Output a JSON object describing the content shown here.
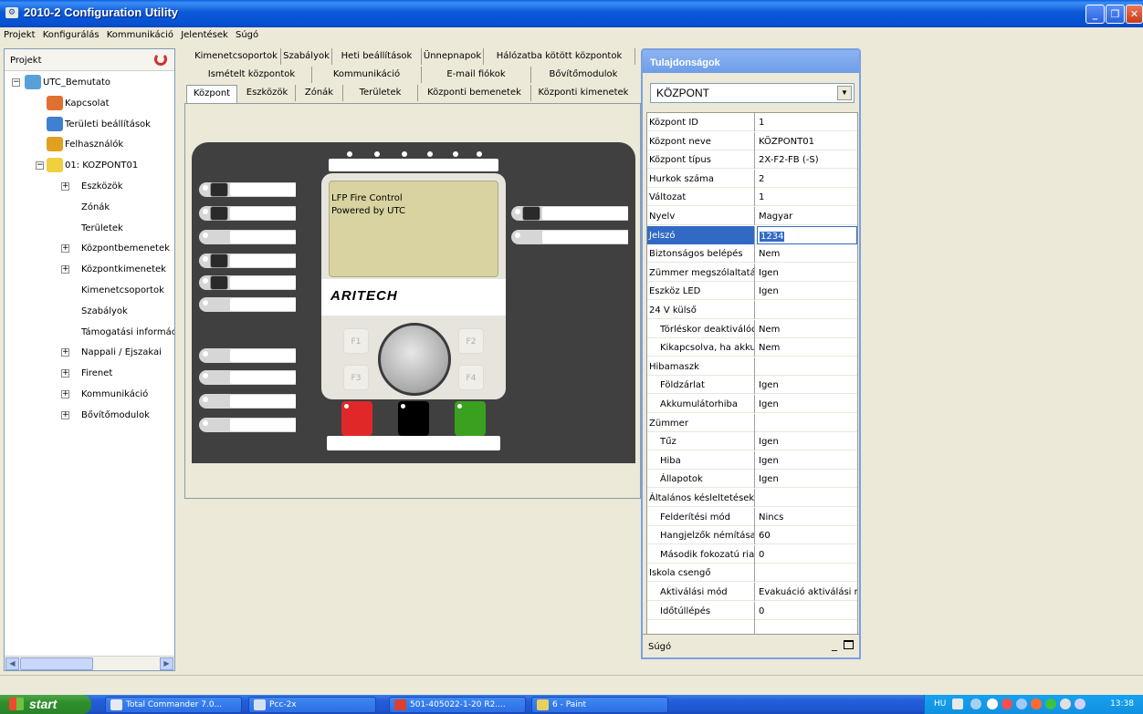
{
  "window": {
    "title": "2010-2 Configuration Utility"
  },
  "menu": [
    "Projekt",
    "Konfigurálás",
    "Kommunikáció",
    "Jelentések",
    "Súgó"
  ],
  "left_panel": {
    "header": "Projekt",
    "tree": [
      {
        "label": "UTC_Bemutato",
        "level": 0,
        "expander": "−"
      },
      {
        "label": "Kapcsolat",
        "level": 1
      },
      {
        "label": "Területi beállítások",
        "level": 1
      },
      {
        "label": "Felhasználók",
        "level": 1
      },
      {
        "label": "01: KÖZPONT01",
        "level": 1,
        "expander": "−"
      },
      {
        "label": "Eszközök",
        "level": 2,
        "expander": "+"
      },
      {
        "label": "Zónák",
        "level": 2
      },
      {
        "label": "Területek",
        "level": 2
      },
      {
        "label": "Központbemenetek",
        "level": 2,
        "expander": "+"
      },
      {
        "label": "Központkimenetek",
        "level": 2,
        "expander": "+"
      },
      {
        "label": "Kimenetcsoportok",
        "level": 2
      },
      {
        "label": "Szabályok",
        "level": 2
      },
      {
        "label": "Támogatási információ",
        "level": 2
      },
      {
        "label": "Nappali / Éjszakai",
        "level": 2,
        "expander": "+"
      },
      {
        "label": "Firenet",
        "level": 2,
        "expander": "+"
      },
      {
        "label": "Kommunikáció",
        "level": 2,
        "expander": "+"
      },
      {
        "label": "Bővítőmodulok",
        "level": 2,
        "expander": "+"
      }
    ]
  },
  "tabs": {
    "row1": [
      "Kimenetcsoportok",
      "Szabályok",
      "Heti beállítások",
      "Ünnepnapok",
      "Hálózatba kötött központok"
    ],
    "row2": [
      "Ismételt központok",
      "Kommunikáció",
      "E-mail fiókok",
      "Bővítőmodulok"
    ],
    "row3": [
      "Központ",
      "Eszközök",
      "Zónák",
      "Területek",
      "Központi bemenetek",
      "Központi kimenetek"
    ],
    "active": "Központ"
  },
  "panel": {
    "lcd_line1": "LFP Fire Control",
    "lcd_line2": "Powered by UTC",
    "brand": "ARITECH",
    "fkeys": [
      "F1",
      "F2",
      "F3",
      "F4"
    ]
  },
  "properties": {
    "title": "Tulajdonságok",
    "selected_object": "KÖZPONT",
    "rows": [
      {
        "key": "Központ ID",
        "value": "1"
      },
      {
        "key": "Központ neve",
        "value": "KÖZPONT01"
      },
      {
        "key": "Központ típus",
        "value": "2X-F2-FB (-S)"
      },
      {
        "key": "Hurkok száma",
        "value": "2"
      },
      {
        "key": "Változat",
        "value": "1"
      },
      {
        "key": "Nyelv",
        "value": "Magyar"
      },
      {
        "key": "Jelszó",
        "value": "1234",
        "selected": true
      },
      {
        "key": "Biztonságos belépés",
        "value": "Nem"
      },
      {
        "key": "Zümmer megszólaltatás",
        "value": "Igen"
      },
      {
        "key": "Eszköz LED",
        "value": "Igen"
      },
      {
        "key": "24 V külső",
        "value": ""
      },
      {
        "key": "Törléskor deaktiválódik",
        "value": "Nem",
        "indent": true
      },
      {
        "key": "Kikapcsolva, ha akku",
        "value": "Nem",
        "indent": true
      },
      {
        "key": "Hibamaszk",
        "value": ""
      },
      {
        "key": "Földzárlat",
        "value": "Igen",
        "indent": true
      },
      {
        "key": "Akkumulátorhiba",
        "value": "Igen",
        "indent": true
      },
      {
        "key": "Zümmer",
        "value": ""
      },
      {
        "key": "Tűz",
        "value": "Igen",
        "indent": true
      },
      {
        "key": "Hiba",
        "value": "Igen",
        "indent": true
      },
      {
        "key": "Állapotok",
        "value": "Igen",
        "indent": true
      },
      {
        "key": "Általános késleltetések",
        "value": ""
      },
      {
        "key": "Felderítési mód",
        "value": "Nincs",
        "indent": true
      },
      {
        "key": "Hangjelzők némítása",
        "value": "60",
        "indent": true
      },
      {
        "key": "Második fokozatú riasztás",
        "value": "0",
        "indent": true
      },
      {
        "key": "Iskola csengő",
        "value": ""
      },
      {
        "key": "Aktiválási mód",
        "value": "Evakuáció aktiválási mód",
        "indent": true
      },
      {
        "key": "Időtúllépés",
        "value": "0",
        "indent": true
      },
      {
        "key": "",
        "value": ""
      }
    ],
    "help_label": "Súgó"
  },
  "taskbar": {
    "start": "start",
    "tasks": [
      "Total Commander 7.0...",
      "Pcc-2x",
      "501-405022-1-20 R2....",
      "6 - Paint"
    ],
    "lang": "HU",
    "clock": "13:38"
  },
  "colors": {
    "titlebar": "#0b58d8",
    "selection": "#316ac5",
    "panel_dark": "#404040",
    "btn_red": "#e02828",
    "btn_black": "#000000",
    "btn_green": "#3aa020"
  }
}
